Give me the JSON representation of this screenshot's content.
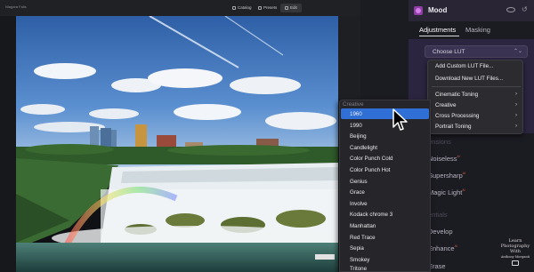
{
  "toolbar": {
    "file_name": "Niagara Falls",
    "catalog_label": "Catalog",
    "presets_label": "Presets",
    "edit_label": "Edit"
  },
  "panel": {
    "title": "Mood",
    "tabs": [
      {
        "label": "Adjustments",
        "active": true
      },
      {
        "label": "Masking",
        "active": false
      }
    ],
    "lut_select": {
      "value": "Choose LUT"
    },
    "lut_menu": {
      "items": [
        {
          "label": "Add Custom LUT File...",
          "has_submenu": false
        },
        {
          "label": "Download New LUT Files...",
          "has_submenu": false
        },
        {
          "label": "Cinematic Toning",
          "has_submenu": true
        },
        {
          "label": "Creative",
          "has_submenu": true
        },
        {
          "label": "Cross Processing",
          "has_submenu": true
        },
        {
          "label": "Portrait Toning",
          "has_submenu": true
        }
      ]
    },
    "side_items": [
      {
        "label": "ensions",
        "dim": true,
        "pro": false
      },
      {
        "label": "Noiseless",
        "dim": false,
        "pro": true
      },
      {
        "label": "Supersharp",
        "dim": false,
        "pro": true
      },
      {
        "label": "Magic Light",
        "dim": false,
        "pro": true
      },
      {
        "label": "entials",
        "dim": true,
        "pro": false
      },
      {
        "label": "Develop",
        "dim": false,
        "pro": false
      },
      {
        "label": "Enhance",
        "dim": false,
        "pro": true
      },
      {
        "label": "Erase",
        "dim": false,
        "pro": false
      }
    ],
    "pro_mark": "ᴬᴵ"
  },
  "creative_submenu": {
    "header": "Creative",
    "selected": "1960",
    "items": [
      "1960",
      "1990",
      "Beijing",
      "Candlelight",
      "Color Punch Cold",
      "Color Punch Hot",
      "Genius",
      "Grace",
      "Involve",
      "Kodack chrome 3",
      "Manhattan",
      "Red Trace",
      "Sepia",
      "Smokey",
      "Tritone"
    ]
  },
  "watermark": {
    "line1": "Learn",
    "line2": "Photography",
    "line3": "With",
    "line4": "Anthony Morganti"
  },
  "colors": {
    "accent_selection": "#2f6fd6",
    "mood_icon": "#8e3ea4",
    "panel_header": "#2a2534",
    "ai_badge": "#d05a3e"
  }
}
